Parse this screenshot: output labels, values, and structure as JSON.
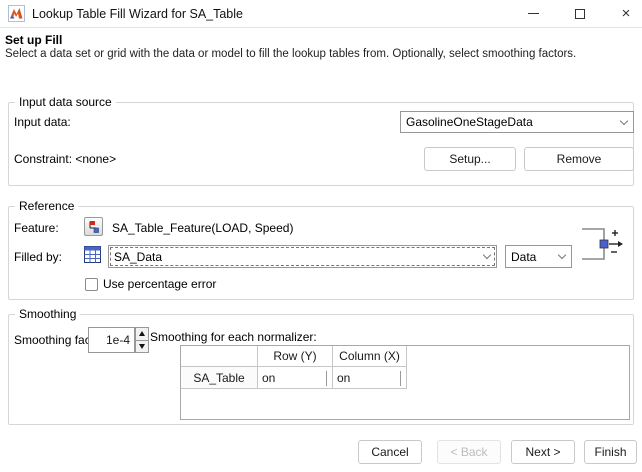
{
  "window": {
    "title": "Lookup Table Fill Wizard for SA_Table"
  },
  "colors": {
    "matlab_orange": "#d95319",
    "icon_blue": "#4a66c0",
    "flag_red": "#cc2a1e",
    "group_border": "#d6d6d6"
  },
  "icons": {
    "matlab_logo": "matlab-membrane",
    "minimize": "thin-line",
    "maximize": "square-outline",
    "close": "×",
    "feature": "model-block-with-flag",
    "filled_by": "blue-table-grid",
    "junction": "bracket-port-plus-minus",
    "combo_chevron": "v",
    "spin_up": "black-triangle-up",
    "spin_down": "black-triangle-down"
  },
  "header": {
    "title": "Set up Fill",
    "description": "Select a data set or grid with the data or model to fill the lookup tables from. Optionally, select smoothing factors."
  },
  "input_data_source": {
    "group_label": "Input data source",
    "input_data_label": "Input data:",
    "input_data_value": "GasolineOneStageData",
    "constraint_label": "Constraint: <none>",
    "setup_button": "Setup...",
    "remove_button": "Remove"
  },
  "reference": {
    "group_label": "Reference",
    "feature_label": "Feature:",
    "feature_value": "SA_Table_Feature(LOAD, Speed)",
    "filled_by_label": "Filled by:",
    "filled_by_value": "SA_Data",
    "fill_type_value": "Data",
    "use_percentage_error_label": "Use percentage error",
    "use_percentage_error_checked": false
  },
  "smoothing": {
    "group_label": "Smoothing",
    "factor_label": "Smoothing factor:",
    "factor_value": "1e-4",
    "normalizer_label": "Smoothing for each normalizer:",
    "table": {
      "columns": [
        "",
        "Row (Y)",
        "Column (X)"
      ],
      "rows": [
        {
          "name": "SA_Table",
          "row_y": "on",
          "column_x": "on"
        }
      ]
    }
  },
  "footer": {
    "cancel_button": "Cancel",
    "back_button": "< Back",
    "next_button": "Next >",
    "finish_button": "Finish"
  }
}
